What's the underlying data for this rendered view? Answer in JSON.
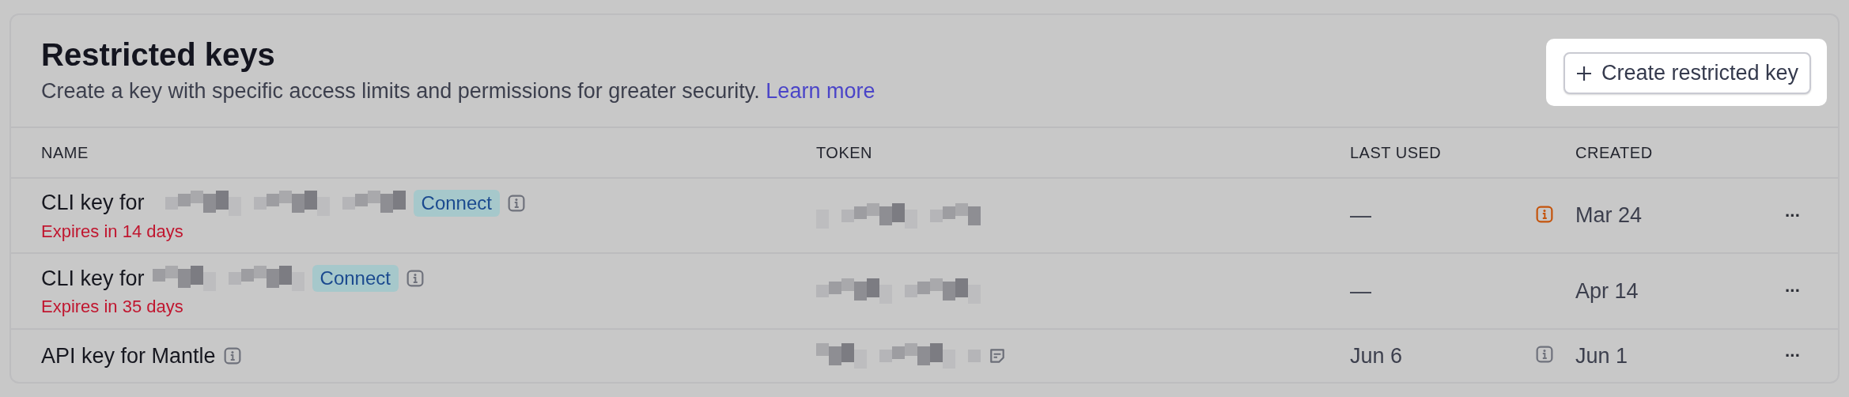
{
  "header": {
    "title": "Restricted keys",
    "description": "Create a key with specific access limits and permissions for greater security.",
    "link": "Learn more",
    "button": "Create restricted key",
    "button_highlighted": true
  },
  "table": {
    "columns": [
      "NAME",
      "TOKEN",
      "LAST USED",
      "CREATED"
    ],
    "rows": [
      {
        "name": "CLI key for",
        "name_redacted": true,
        "badge": "Connect",
        "expiry": "Expires in 14 days",
        "token_note": false,
        "last_used": "—",
        "notice": true,
        "notice_warning": true,
        "created": "Mar 24",
        "actions": "···"
      },
      {
        "name": "CLI key for",
        "name_redacted": true,
        "badge": "Connect",
        "expiry": "Expires in 35 days",
        "token_note": false,
        "last_used": "—",
        "notice": false,
        "created": "Apr 14",
        "actions": "···"
      },
      {
        "name": "API key for Mantle",
        "name_redacted": false,
        "token_note": true,
        "last_used": "Jun 6",
        "notice": true,
        "notice_warning": false,
        "created": "Jun 1",
        "actions": "···"
      }
    ]
  }
}
